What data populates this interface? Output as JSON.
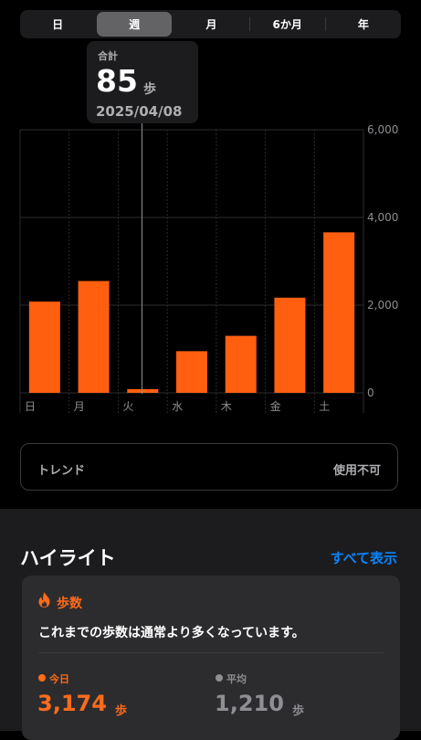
{
  "segments": [
    {
      "label": "日",
      "selected": false
    },
    {
      "label": "週",
      "selected": true
    },
    {
      "label": "月",
      "selected": false
    },
    {
      "label": "6か月",
      "selected": false
    },
    {
      "label": "年",
      "selected": false
    }
  ],
  "tooltip": {
    "label": "合計",
    "value": "85",
    "unit": "歩",
    "date": "2025/04/08"
  },
  "chart_data": {
    "type": "bar",
    "categories": [
      "日",
      "月",
      "火",
      "水",
      "木",
      "金",
      "土"
    ],
    "values": [
      2080,
      2550,
      85,
      950,
      1300,
      2170,
      3660
    ],
    "ylim": [
      0,
      6000
    ],
    "yticks": [
      "6,000",
      "4,000",
      "2,000",
      "0"
    ],
    "bar_color": "#ff5f0f",
    "grid": true,
    "selected_index": 2
  },
  "trend": {
    "label": "トレンド",
    "value": "使用不可"
  },
  "highlights": {
    "title": "ハイライト",
    "link": "すべて表示",
    "card": {
      "category": "歩数",
      "message": "これまでの歩数は通常より多くなっています。",
      "today": {
        "label": "今日",
        "value": "3,174",
        "unit": "歩",
        "color": "#ff6b1a"
      },
      "average": {
        "label": "平均",
        "value": "1,210",
        "unit": "歩",
        "color": "#8e8e93"
      }
    }
  }
}
